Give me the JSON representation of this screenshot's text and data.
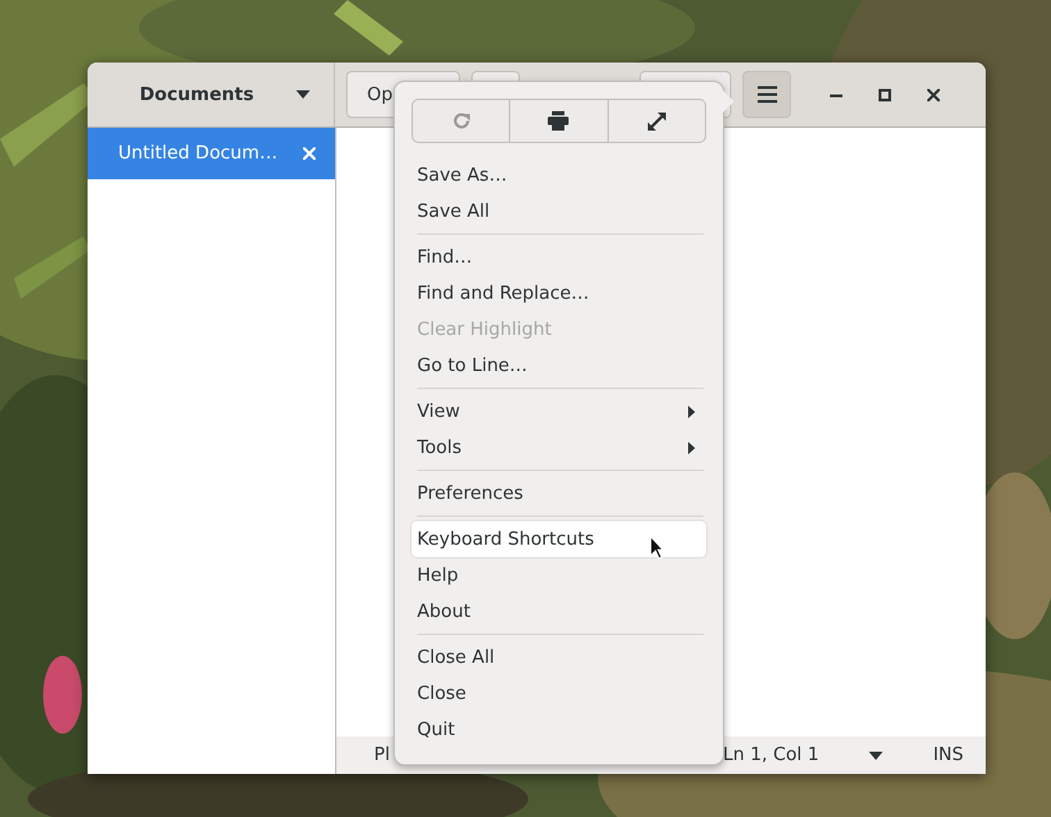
{
  "sidebar": {
    "title": "Documents",
    "documents": [
      {
        "title": "Untitled Docum…",
        "selected": true
      }
    ]
  },
  "header_buttons": [
    {
      "kind": "text",
      "label": "Op"
    },
    {
      "kind": "blank"
    },
    {
      "kind": "blank"
    }
  ],
  "menu_button": {
    "pressed": true
  },
  "status_bar": {
    "language": "Pl",
    "position": "Ln 1, Col 1",
    "mode": "INS"
  },
  "popover": {
    "icon_buttons": [
      {
        "kind": "reload"
      },
      {
        "kind": "print"
      },
      {
        "kind": "fullscreen"
      }
    ],
    "sections": [
      [
        {
          "label": "Save As…",
          "kind": "action",
          "disabled": false,
          "highlighted": false
        },
        {
          "label": "Save All",
          "kind": "action",
          "disabled": false,
          "highlighted": false
        }
      ],
      [
        {
          "label": "Find…",
          "kind": "action",
          "disabled": false,
          "highlighted": false
        },
        {
          "label": "Find and Replace…",
          "kind": "action",
          "disabled": false,
          "highlighted": false
        },
        {
          "label": "Clear Highlight",
          "kind": "action",
          "disabled": true,
          "highlighted": false
        },
        {
          "label": "Go to Line…",
          "kind": "action",
          "disabled": false,
          "highlighted": false
        }
      ],
      [
        {
          "label": "View",
          "kind": "submenu",
          "disabled": false,
          "highlighted": false
        },
        {
          "label": "Tools",
          "kind": "submenu",
          "disabled": false,
          "highlighted": false
        }
      ],
      [
        {
          "label": "Preferences",
          "kind": "action",
          "disabled": false,
          "highlighted": false
        }
      ],
      [
        {
          "label": "Keyboard Shortcuts",
          "kind": "action",
          "disabled": false,
          "highlighted": true
        },
        {
          "label": "Help",
          "kind": "action",
          "disabled": false,
          "highlighted": false
        },
        {
          "label": "About",
          "kind": "action",
          "disabled": false,
          "highlighted": false
        }
      ],
      [
        {
          "label": "Close All",
          "kind": "action",
          "disabled": false,
          "highlighted": false
        },
        {
          "label": "Close",
          "kind": "action",
          "disabled": false,
          "highlighted": false
        },
        {
          "label": "Quit",
          "kind": "action",
          "disabled": false,
          "highlighted": false
        }
      ]
    ]
  }
}
